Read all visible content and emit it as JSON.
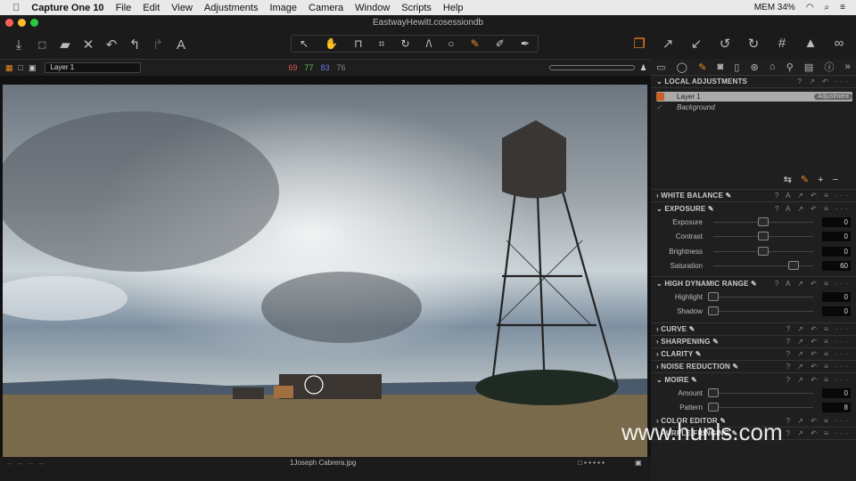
{
  "menubar": {
    "apple": "",
    "app": "Capture One 10",
    "items": [
      "File",
      "Edit",
      "View",
      "Adjustments",
      "Image",
      "Camera",
      "Window",
      "Scripts",
      "Help"
    ],
    "status": "MEM 34%"
  },
  "window": {
    "title": "EastwayHewitt.cosessiondb"
  },
  "subbar": {
    "layer": "Layer 1",
    "rgb": [
      "69",
      "77",
      "83",
      "76"
    ]
  },
  "panel": {
    "local_adjustments": "LOCAL ADJUSTMENTS",
    "layers": [
      {
        "name": "Layer 1",
        "badge": "Adjustment"
      },
      {
        "name": "Background"
      }
    ],
    "white_balance": "WHITE BALANCE",
    "exposure": {
      "title": "EXPOSURE",
      "rows": [
        {
          "label": "Exposure",
          "value": "0",
          "pos": 0
        },
        {
          "label": "Contrast",
          "value": "0",
          "pos": 0
        },
        {
          "label": "Brightness",
          "value": "0",
          "pos": 0
        },
        {
          "label": "Saturation",
          "value": "60",
          "pos": 60
        }
      ]
    },
    "hdr": {
      "title": "HIGH DYNAMIC RANGE",
      "rows": [
        {
          "label": "Highlight",
          "value": "0"
        },
        {
          "label": "Shadow",
          "value": "0"
        }
      ]
    },
    "curve": "CURVE",
    "sharpening": "SHARPENING",
    "clarity": "CLARITY",
    "noise": "NOISE REDUCTION",
    "moire": {
      "title": "MOIRE",
      "rows": [
        {
          "label": "Amount",
          "value": "0"
        },
        {
          "label": "Pattern",
          "value": "8"
        }
      ]
    },
    "color_editor": "COLOR EDITOR",
    "purple": "PURPLE FRINGING"
  },
  "bottom": {
    "filename": "1Joseph Cabrera.jpg"
  },
  "watermark": "www.hunls.com"
}
